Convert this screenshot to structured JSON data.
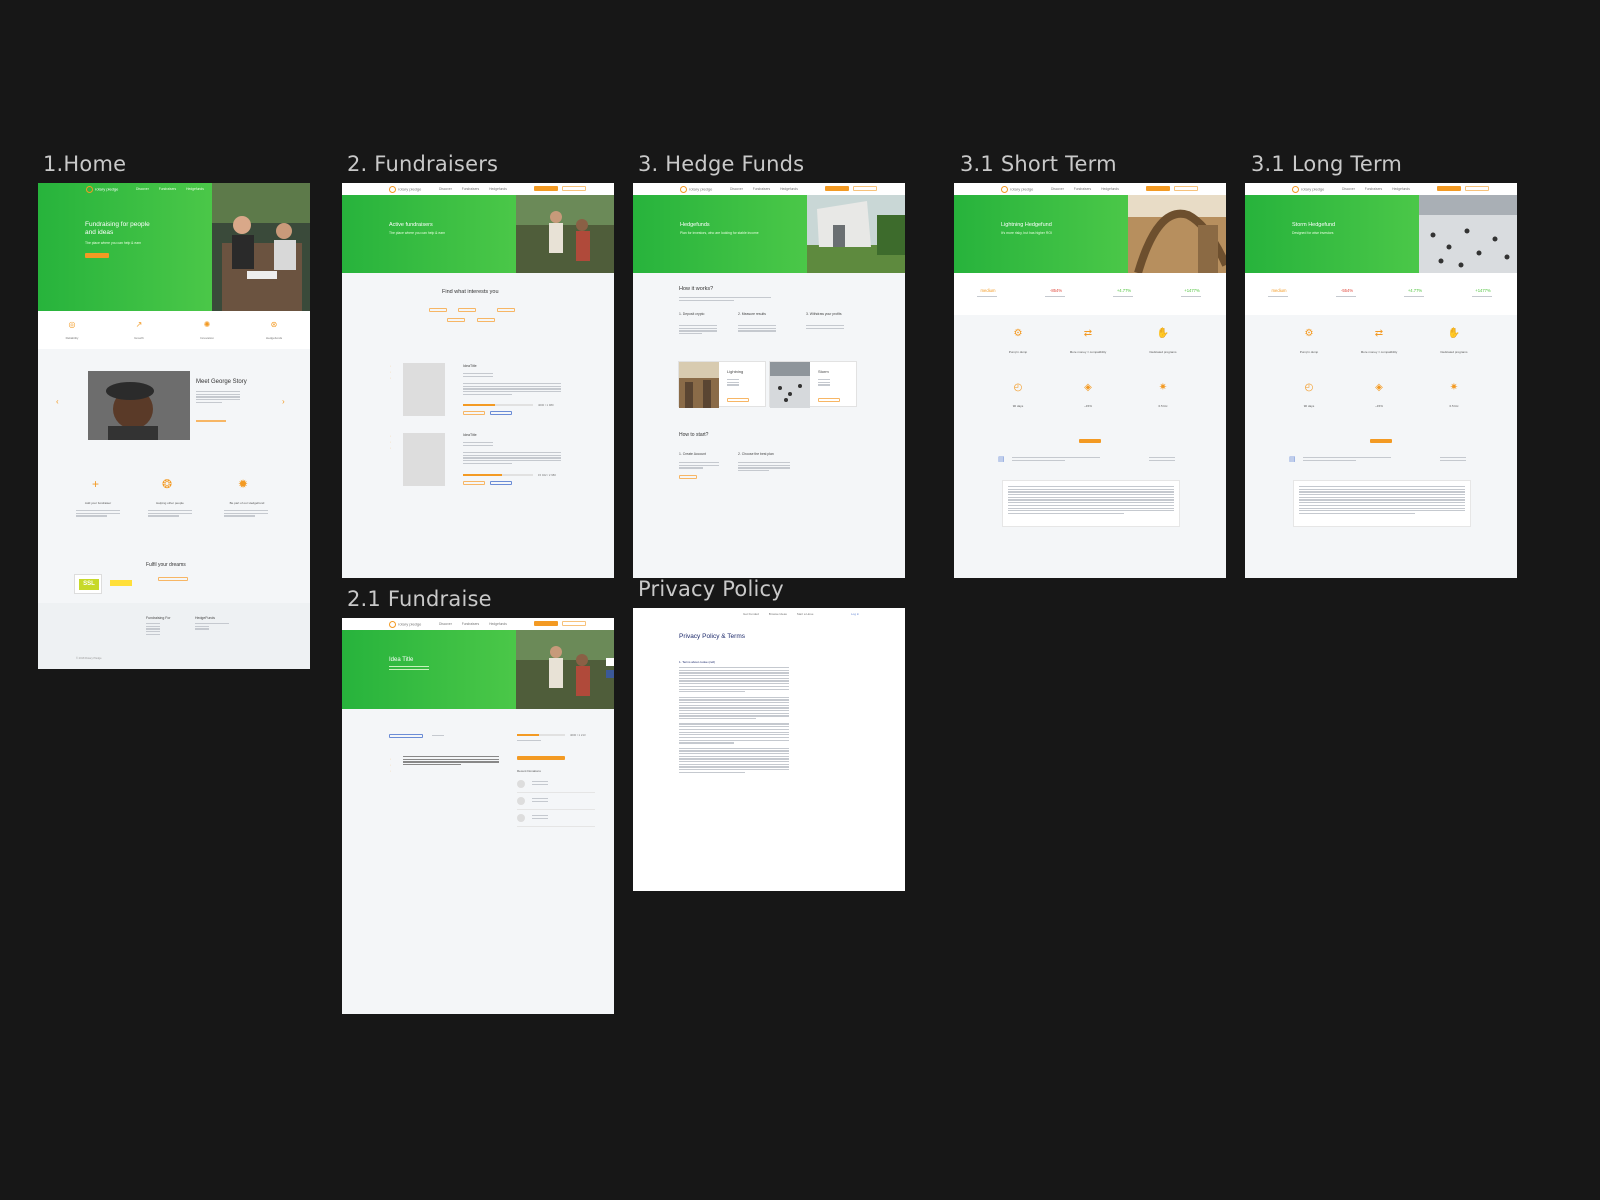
{
  "boards": {
    "home": {
      "label": "1.Home"
    },
    "fundraisers": {
      "label": "2. Fundraisers"
    },
    "hedge_funds": {
      "label": "3. Hedge Funds"
    },
    "short_term": {
      "label": "3.1 Short Term"
    },
    "long_term": {
      "label": "3.1 Long Term"
    },
    "fundraise": {
      "label": "2.1 Fundraise"
    },
    "privacy": {
      "label": "Privacy Policy"
    }
  },
  "common": {
    "logo_text": "rotary pledge",
    "nav": {
      "item1": "Discover",
      "item2": "Fundraisers",
      "item3": "Hedgefunds"
    },
    "colors": {
      "accent": "#f39a23",
      "green_start": "#27b33c",
      "green_end": "#5fd34f",
      "canvas": "#171717",
      "board_bg": "#f4f6f8",
      "link_blue": "#6b8cd6"
    }
  },
  "home": {
    "hero_title_line1": "Fundraising for people",
    "hero_title_line2": "and ideas",
    "hero_subtitle": "The place where you can help & earn",
    "features": [
      {
        "icon": "shield-icon",
        "label": "Reliability"
      },
      {
        "icon": "growth-icon",
        "label": "Growth"
      },
      {
        "icon": "lightbulb-icon",
        "label": "Innovation"
      },
      {
        "icon": "piggy-bank-icon",
        "label": "Hedgefunds"
      }
    ],
    "story_title": "Meet George Story",
    "how": [
      {
        "icon": "plus-icon",
        "label": "Add your fundraiser"
      },
      {
        "icon": "helping-icon",
        "label": "Helping other people"
      },
      {
        "icon": "sun-icon",
        "label": "Be part of our HedgeFund"
      }
    ],
    "dreams_title": "Fulfil your dreams",
    "badge_ssl": "SSL",
    "footer_col1_title": "Fundraising For",
    "footer_col2_title": "HedgeFunds",
    "copyright": "© 2018 Rotary Pledge"
  },
  "fundraisers": {
    "hero_title": "Active fundraisers",
    "hero_subtitle": "The place where you can help & earn",
    "section_title": "Find what interests you",
    "items": [
      {
        "title": "IdeaTitle",
        "amount": "4000 / 1 980"
      },
      {
        "title": "IdeaTitle",
        "amount": "15 022 / 2 980"
      }
    ]
  },
  "hedge_funds": {
    "hero_title": "Hedgefunds",
    "hero_subtitle": "Plan for investors, who are looking for stable income",
    "how_title": "How it works?",
    "steps": [
      "1. Deposit crypto",
      "2. Measure results",
      "3. Withdraw your profits"
    ],
    "cards": [
      {
        "title": "Lightning"
      },
      {
        "title": "Storm"
      }
    ],
    "start_title": "How to start?",
    "start_steps": [
      "1. Create Account",
      "2. Choose the best plan"
    ]
  },
  "short_term": {
    "hero_title": "Lightning Hedgefund",
    "hero_subtitle": "It's more risky, but has higher ROI",
    "stats": [
      {
        "value": "medium",
        "color": "#f39a23"
      },
      {
        "value": "-854%",
        "color": "#e0473b"
      },
      {
        "value": "+4.77%",
        "color": "#4fc43c"
      },
      {
        "value": "+1477%",
        "color": "#4fc43c"
      }
    ],
    "features": [
      {
        "icon": "pump-icon",
        "label": "Pump'n dump"
      },
      {
        "icon": "exchange-icon",
        "label": "More money = compatibility"
      },
      {
        "icon": "hand-coin-icon",
        "label": "Dedicated programs"
      },
      {
        "icon": "clock-icon",
        "label": "90 days"
      },
      {
        "icon": "coins-icon",
        "label": "~15%"
      },
      {
        "icon": "gear-icon",
        "label": "0.5 btc"
      }
    ]
  },
  "long_term": {
    "hero_title": "Storm Hedgefund",
    "hero_subtitle": "Designed for wise investors",
    "stats": [
      {
        "value": "medium",
        "color": "#f39a23"
      },
      {
        "value": "-554%",
        "color": "#e0473b"
      },
      {
        "value": "+4.77%",
        "color": "#4fc43c"
      },
      {
        "value": "+1477%",
        "color": "#4fc43c"
      }
    ],
    "features": [
      {
        "icon": "pump-icon",
        "label": "Pump'n dump"
      },
      {
        "icon": "exchange-icon",
        "label": "More money = compatibility"
      },
      {
        "icon": "hand-coin-icon",
        "label": "Dedicated programs"
      },
      {
        "icon": "clock-icon",
        "label": "90 days"
      },
      {
        "icon": "coins-icon",
        "label": "~15%"
      },
      {
        "icon": "gear-icon",
        "label": "0.5 btc"
      }
    ]
  },
  "fundraise": {
    "hero_title": "Idea Title",
    "amount": "4000 / 1 213",
    "recent_title": "Recent Donations"
  },
  "privacy": {
    "nav": {
      "item1": "Get Funded",
      "item2": "Browse Ideas",
      "item3": "Start a Hose",
      "item4": "Log in"
    },
    "title": "Privacy Policy & Terms",
    "section_title": "1. Terms about cooke (cell)"
  }
}
